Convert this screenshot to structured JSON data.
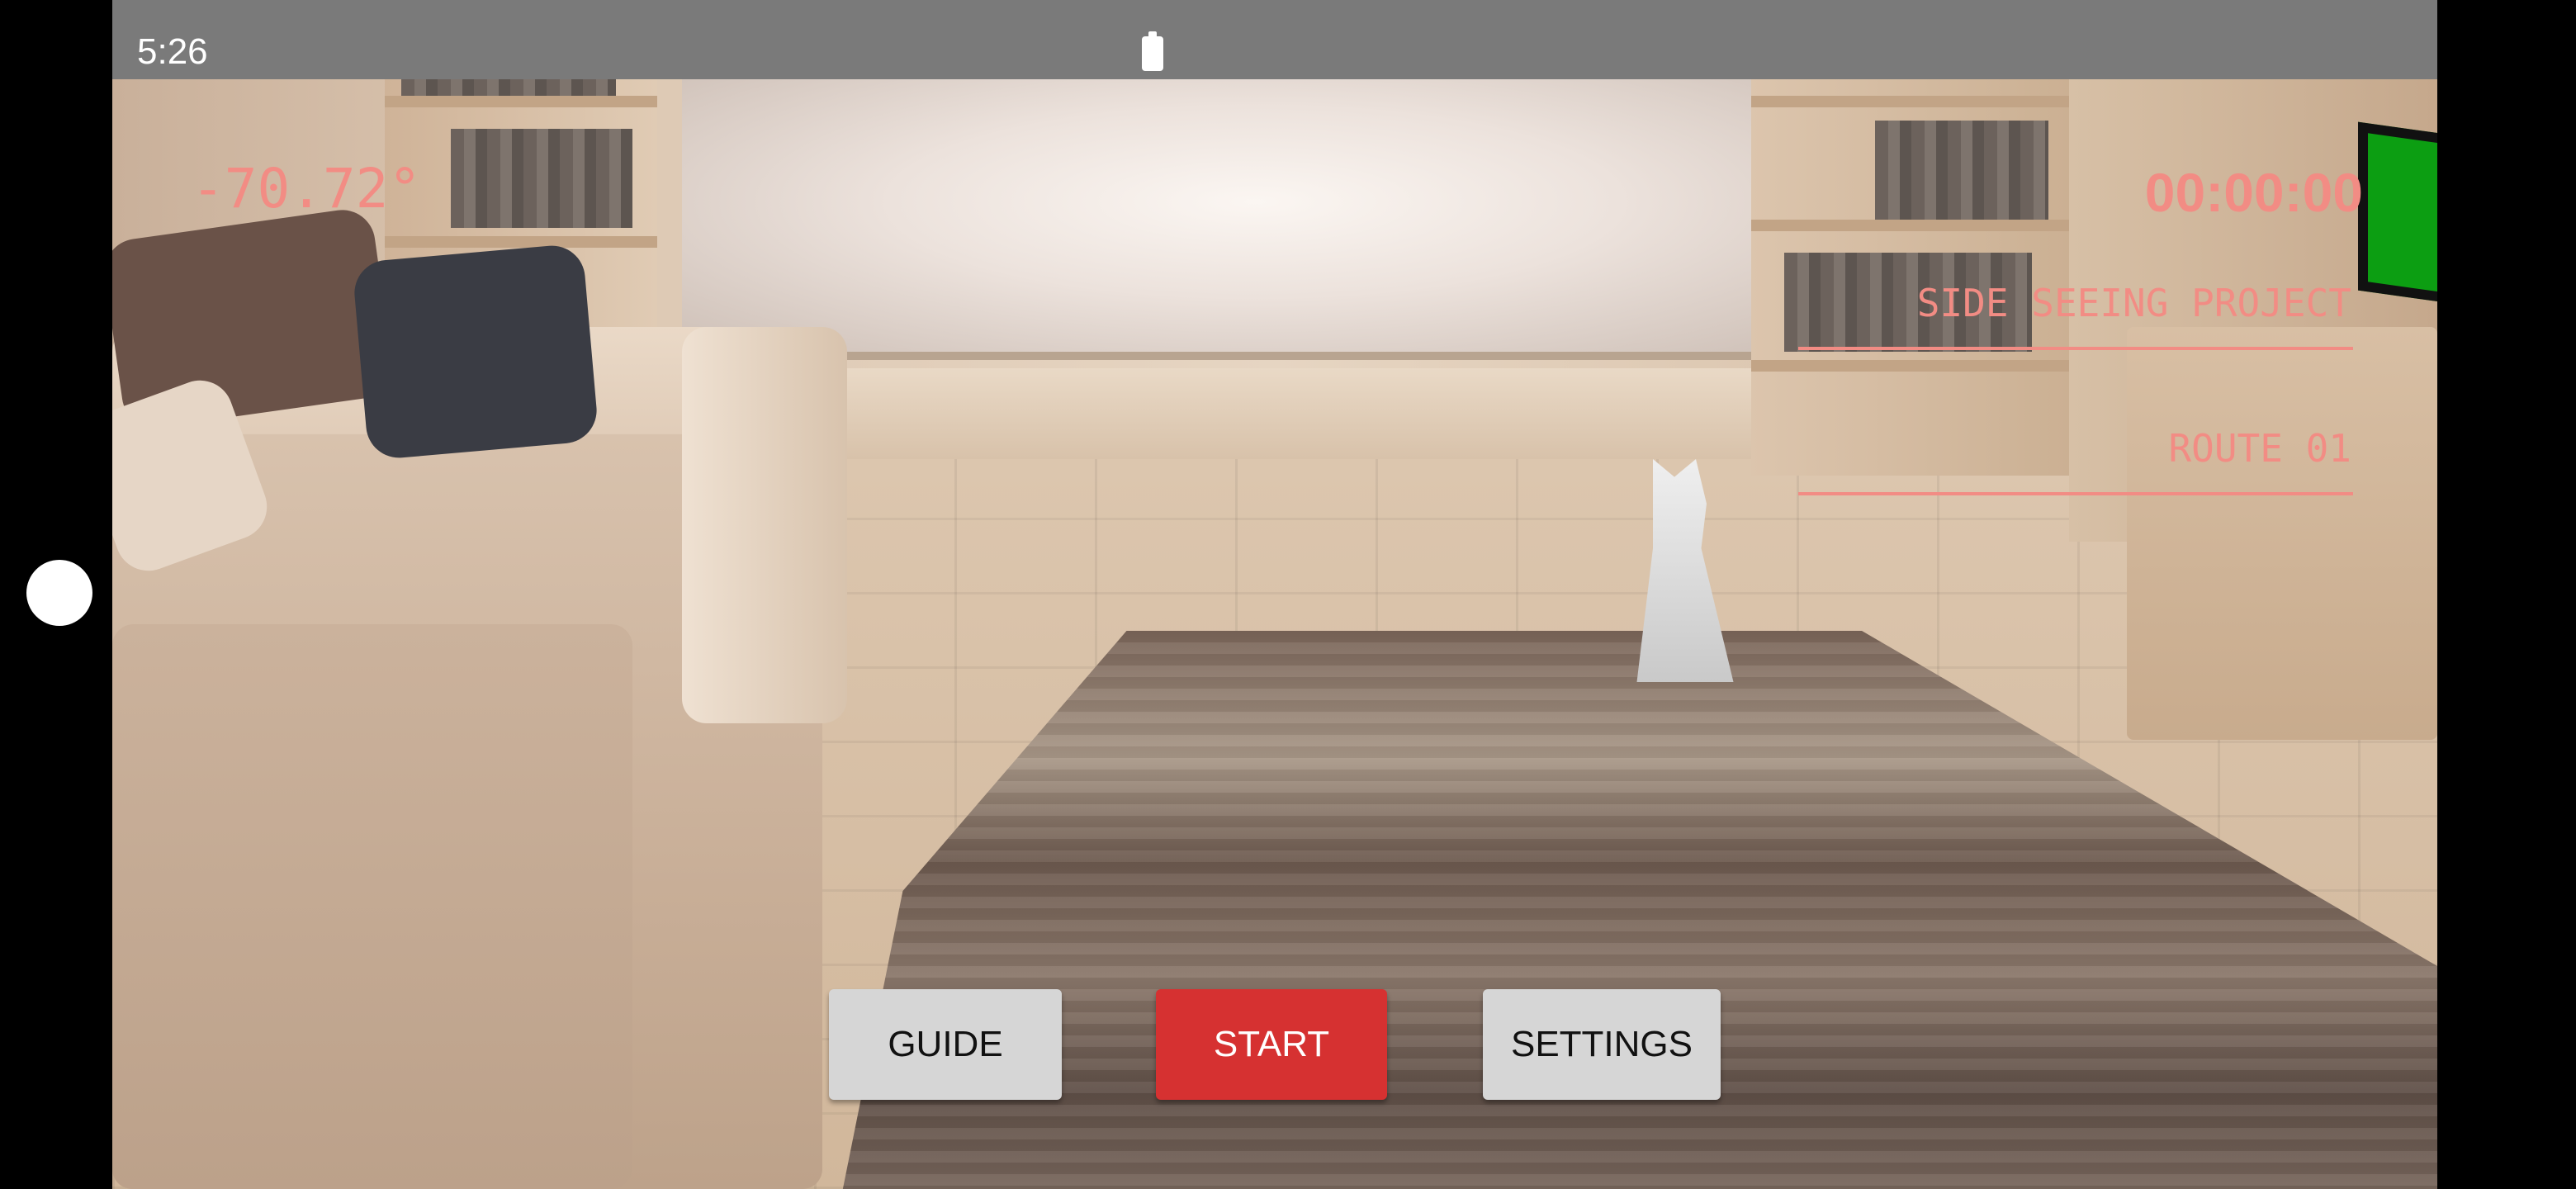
{
  "status_bar": {
    "time": "5:26",
    "battery_icon": "battery-full-icon"
  },
  "hud": {
    "angle": "-70.72°",
    "timer": "00:00:00",
    "project": "SIDE SEEING PROJECT",
    "route": "ROUTE 01"
  },
  "buttons": {
    "guide": "GUIDE",
    "start": "START",
    "settings": "SETTINGS"
  },
  "colors": {
    "overlay_text": "#f28c84",
    "start_button": "#d63131",
    "secondary_button": "#d6d6d6",
    "status_bar": "#7a7a7a"
  }
}
